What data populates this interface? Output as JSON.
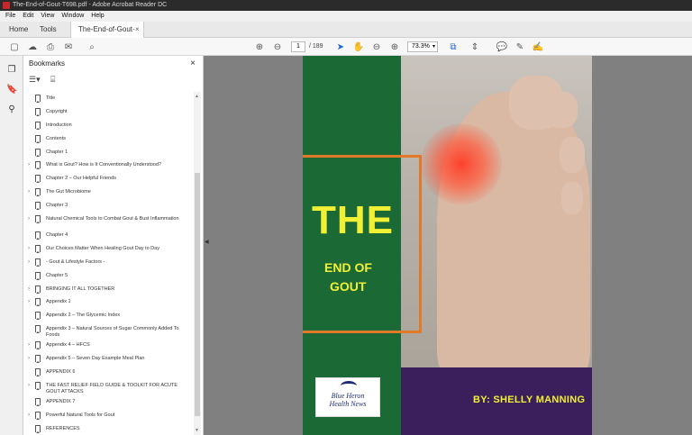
{
  "window": {
    "title": "The-End-of-Gout-T698.pdf - Adobe Acrobat Reader DC"
  },
  "menu": [
    "File",
    "Edit",
    "View",
    "Window",
    "Help"
  ],
  "tabs": {
    "home": "Home",
    "tools": "Tools",
    "document": "The-End-of-Gout-7...",
    "close": "×"
  },
  "toolbar": {
    "page_current": "1",
    "page_total": "/ 189",
    "zoom": "73.3%"
  },
  "panel": {
    "title": "Bookmarks",
    "close": "×",
    "bookmarks": [
      {
        "label": "Title",
        "expandable": false
      },
      {
        "label": "Copyright",
        "expandable": false
      },
      {
        "label": "Introduction",
        "expandable": false
      },
      {
        "label": "Contents",
        "expandable": false
      },
      {
        "label": "Chapter 1",
        "expandable": false
      },
      {
        "label": "What is Gout? How is It Conventionally Understood?",
        "expandable": true
      },
      {
        "label": "Chapter 2 – Our Helpful Friends",
        "expandable": false
      },
      {
        "label": "The Gut Microbiome",
        "expandable": true
      },
      {
        "label": "Chapter 3",
        "expandable": false
      },
      {
        "label": "Natural Chemical Tools to Combat Gout & Bust Inflammation",
        "expandable": true
      },
      {
        "label": "Chapter 4",
        "expandable": false
      },
      {
        "label": "Our Choices Matter When Healing Gout Day to Day",
        "expandable": true
      },
      {
        "label": "- Gout & Lifestyle Factors -",
        "expandable": true
      },
      {
        "label": "Chapter 5",
        "expandable": false
      },
      {
        "label": "BRINGING IT ALL TOGETHER",
        "expandable": true
      },
      {
        "label": "Appendix 1",
        "expandable": true
      },
      {
        "label": "Appendix 2 – The Glycemic Index",
        "expandable": false
      },
      {
        "label": "Appendix 3 – Natural Sources of Sugar Commonly Added To Foods",
        "expandable": false
      },
      {
        "label": "Appendix 4 – HFCS",
        "expandable": true
      },
      {
        "label": "Appendix 5 – Seven Day Example Meal Plan",
        "expandable": true
      },
      {
        "label": "APPENDIX 6",
        "expandable": false
      },
      {
        "label": "THE FAST RELIEF FIELD GUIDE & TOOLKIT FOR ACUTE GOUT ATTACKS",
        "expandable": true
      },
      {
        "label": "APPENDIX 7",
        "expandable": false
      },
      {
        "label": "Powerful Natural Tools for Gout",
        "expandable": true
      },
      {
        "label": "REFERENCES",
        "expandable": false
      }
    ]
  },
  "cover": {
    "title_big": "THE",
    "title_line2": "END OF",
    "title_line3": "GOUT",
    "author": "BY: SHELLY MANNING",
    "logo_line1": "Blue Heron",
    "logo_line2": "Health News",
    "colors": {
      "green": "#1b6a35",
      "yellow": "#f2f035",
      "orange": "#e07a2a",
      "purple": "#3a1f5c"
    }
  },
  "icons": {
    "sidebar": [
      "page-thumbnails-icon",
      "bookmark-icon",
      "attachment-icon"
    ],
    "toolbar": [
      "save-icon",
      "upload-icon",
      "print-icon",
      "email-icon",
      "page-up-icon",
      "page-down-icon",
      "select-cursor-icon",
      "hand-icon",
      "zoom-out-icon",
      "zoom-in-icon",
      "fit-page-icon",
      "scroll-mode-icon",
      "comment-icon",
      "highlight-pen-icon",
      "sign-icon"
    ]
  }
}
